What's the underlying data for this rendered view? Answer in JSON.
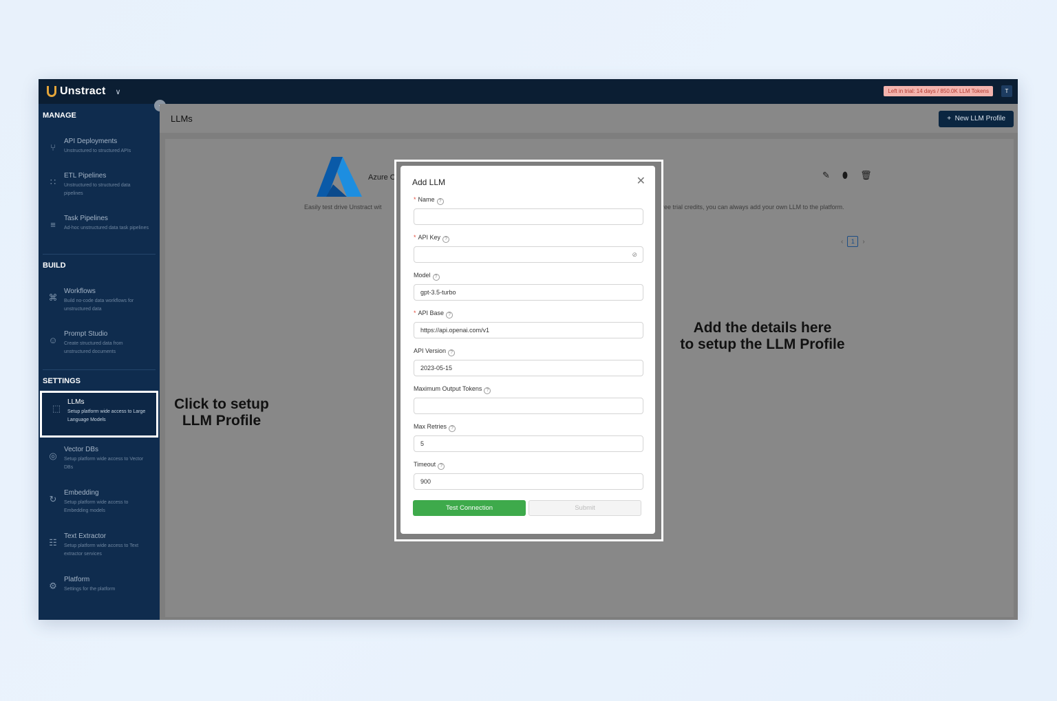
{
  "app": {
    "brand": "Unstract",
    "trial_badge": "Left in trial: 14 days / 850.0K LLM Tokens",
    "avatar_initial": "T"
  },
  "sidebar": {
    "sections": [
      {
        "label": "MANAGE",
        "items": [
          {
            "label": "API Deployments",
            "desc": "Unstructured to structured APIs",
            "icon": "api-deployments-icon"
          },
          {
            "label": "ETL Pipelines",
            "desc": "Unstructured to structured data pipelines",
            "icon": "etl-pipelines-icon"
          },
          {
            "label": "Task Pipelines",
            "desc": "Ad-hoc unstructured data task pipelines",
            "icon": "task-pipelines-icon"
          }
        ]
      },
      {
        "label": "BUILD",
        "items": [
          {
            "label": "Workflows",
            "desc": "Build no-code data workflows for unstructured data",
            "icon": "workflows-icon"
          },
          {
            "label": "Prompt Studio",
            "desc": "Create structured data from unstructured documents",
            "icon": "prompt-studio-icon"
          }
        ]
      },
      {
        "label": "SETTINGS",
        "items": [
          {
            "label": "LLMs",
            "desc": "Setup platform wide access to Large Language Models",
            "icon": "llms-icon",
            "active": true
          },
          {
            "label": "Vector DBs",
            "desc": "Setup platform wide access to Vector DBs",
            "icon": "vector-db-icon"
          },
          {
            "label": "Embedding",
            "desc": "Setup platform wide access to Embedding models",
            "icon": "embedding-icon"
          },
          {
            "label": "Text Extractor",
            "desc": "Setup platform wide access to Text extractor services",
            "icon": "text-extractor-icon"
          },
          {
            "label": "Platform",
            "desc": "Settings for the platform",
            "icon": "platform-icon"
          }
        ]
      }
    ]
  },
  "header": {
    "title": "LLMs",
    "new_button": "New LLM Profile"
  },
  "card": {
    "name": "Azure O",
    "desc_left": "Easily test drive Unstract wit",
    "desc_right": "ree trial credits, you can always add your own LLM to the platform.",
    "page": "1"
  },
  "modal": {
    "title": "Add LLM",
    "fields": [
      {
        "label": "Name",
        "required": true,
        "value": ""
      },
      {
        "label": "API Key",
        "required": true,
        "value": ""
      },
      {
        "label": "Model",
        "required": false,
        "value": "gpt-3.5-turbo"
      },
      {
        "label": "API Base",
        "required": true,
        "value": "https://api.openai.com/v1"
      },
      {
        "label": "API Version",
        "required": false,
        "value": "2023-05-15"
      },
      {
        "label": "Maximum Output Tokens",
        "required": false,
        "value": ""
      },
      {
        "label": "Max Retries",
        "required": false,
        "value": "5"
      },
      {
        "label": "Timeout",
        "required": false,
        "value": "900"
      }
    ],
    "test_button": "Test Connection",
    "submit_button": "Submit"
  },
  "annotations": {
    "left_line1": "Click to setup",
    "left_line2": "LLM Profile",
    "right_line1": "Add the details here",
    "right_line2": "to setup the LLM Profile"
  },
  "colors": {
    "sidebar_bg": "#0f2c4e",
    "topbar_bg": "#0b1e33",
    "primary_green": "#3eaa4b",
    "required_red": "#e24b3b"
  }
}
